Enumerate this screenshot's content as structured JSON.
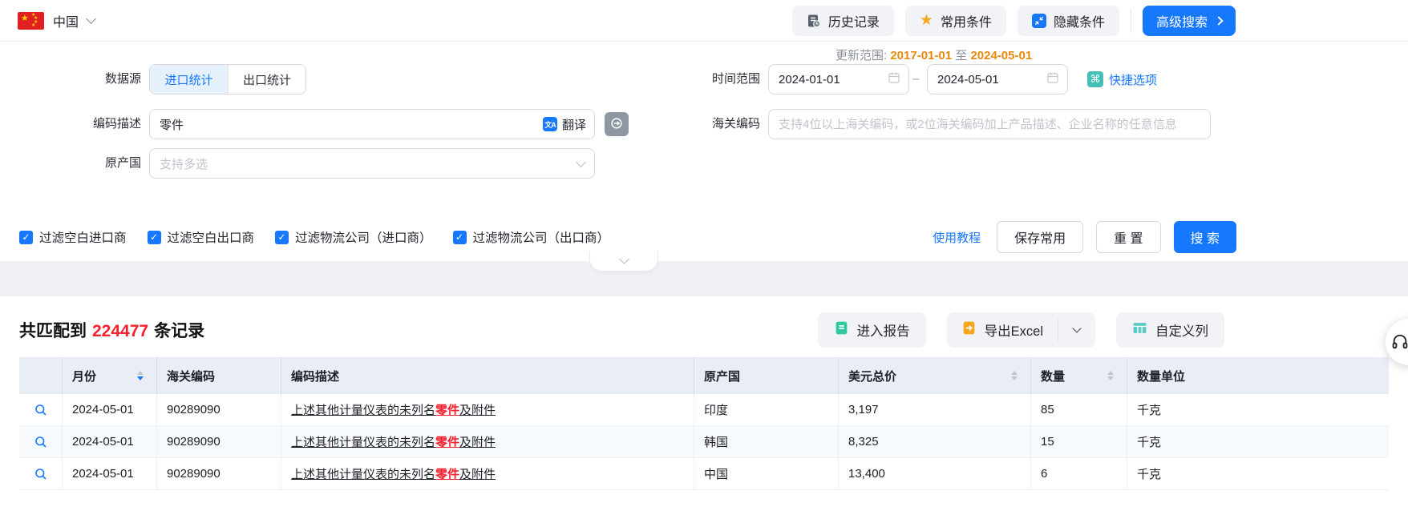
{
  "topbar": {
    "country": "中国",
    "history": "历史记录",
    "favorites": "常用条件",
    "hide_conditions": "隐藏条件",
    "advanced_search": "高级搜索"
  },
  "form": {
    "update_range": {
      "label": "更新范围:",
      "start": "2017-01-01",
      "to": "至",
      "end": "2024-05-01"
    },
    "data_source": {
      "label": "数据源",
      "import_tab": "进口统计",
      "export_tab": "出口统计"
    },
    "time_range": {
      "label": "时间范围",
      "start": "2024-01-01",
      "dash": "–",
      "end": "2024-05-01",
      "quick_options": "快捷选项"
    },
    "code_desc": {
      "label": "编码描述",
      "value": "零件",
      "translate": "翻译"
    },
    "hs_code": {
      "label": "海关编码",
      "placeholder": "支持4位以上海关编码，或2位海关编码加上产品描述、企业名称的任意信息"
    },
    "origin": {
      "label": "原产国",
      "placeholder": "支持多选"
    },
    "filters": [
      "过滤空白进口商",
      "过滤空白出口商",
      "过滤物流公司（进口商）",
      "过滤物流公司（出口商）"
    ],
    "actions": {
      "tutorial": "使用教程",
      "save": "保存常用",
      "reset": "重 置",
      "search": "搜 索"
    }
  },
  "results": {
    "summary": {
      "prefix": "共匹配到",
      "count": "224477",
      "suffix": "条记录"
    },
    "toolbar": {
      "report": "进入报告",
      "export_excel": "导出Excel",
      "custom_columns": "自定义列"
    },
    "table": {
      "columns": [
        "月份",
        "海关编码",
        "编码描述",
        "原产国",
        "美元总价",
        "数量",
        "数量单位"
      ],
      "rows": [
        {
          "month": "2024-05-01",
          "hs_code": "90289090",
          "desc_pre": "上述其他计量仪表的未列名",
          "desc_highlight": "零件",
          "desc_post": "及附件",
          "origin": "印度",
          "usd_total": "3,197",
          "quantity": "85",
          "unit": "千克"
        },
        {
          "month": "2024-05-01",
          "hs_code": "90289090",
          "desc_pre": "上述其他计量仪表的未列名",
          "desc_highlight": "零件",
          "desc_post": "及附件",
          "origin": "韩国",
          "usd_total": "8,325",
          "quantity": "15",
          "unit": "千克"
        },
        {
          "month": "2024-05-01",
          "hs_code": "90289090",
          "desc_pre": "上述其他计量仪表的未列名",
          "desc_highlight": "零件",
          "desc_post": "及附件",
          "origin": "中国",
          "usd_total": "13,400",
          "quantity": "6",
          "unit": "千克"
        }
      ]
    }
  },
  "icons": {
    "star": "★",
    "command": "⌘",
    "check": "✓",
    "translate_glyph": "文A"
  },
  "colors": {
    "accent": "#1677ff",
    "count_red": "#f5222d",
    "keyword_red": "#f5222d",
    "date_orange": "#e8890c",
    "quick_teal": "#45c0b8",
    "star_orange": "#f7a825",
    "excel_orange": "#f7a61d",
    "report_green": "#2fc9a0",
    "columns_teal": "#5bc8c2",
    "table_header_bg": "#e9edf5"
  }
}
